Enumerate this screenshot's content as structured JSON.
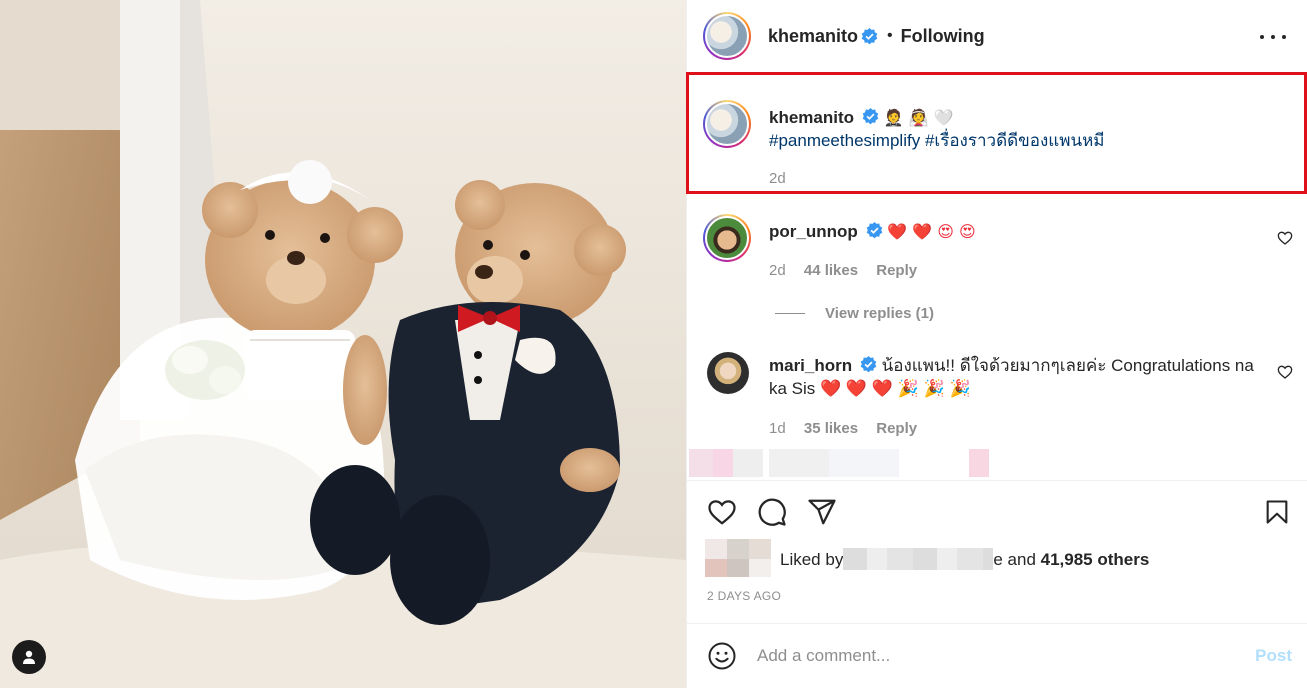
{
  "post": {
    "author": "khemanito",
    "follow_state": "Following",
    "separator": "•"
  },
  "caption": {
    "username": "khemanito",
    "emojis": "🤵 👰 🤍",
    "hashtag_1": "#panmeethesimplify",
    "hashtag_2": "#เรื่องราวดีดีของแพนหมี",
    "time": "2d"
  },
  "comments": [
    {
      "username": "por_unnop",
      "text": "❤️ ❤️ 😍 😍",
      "time": "2d",
      "likes": "44 likes",
      "reply": "Reply"
    },
    {
      "username": "mari_horn",
      "text": "น้องแพน!! ดีใจด้วยมากๆเลยค่ะ Congratulations na ka Sis ❤️ ❤️ ❤️ 🎉 🎉 🎉",
      "time": "1d",
      "likes": "35 likes",
      "reply": "Reply"
    }
  ],
  "view_replies": "View replies (1)",
  "likes_summary": {
    "prefix": "Liked by",
    "suffix_letter": "e",
    "and_text": "and",
    "others": "41,985 others"
  },
  "posted_date": "2 DAYS AGO",
  "comment_field": {
    "placeholder": "Add a comment...",
    "post_label": "Post"
  },
  "colors": {
    "verified": "#3897f0",
    "link": "#00376b",
    "highlight_border": "#e0101a",
    "post_disabled": "#b2dffc",
    "secondary_text": "#8e8e8e"
  },
  "icons": {
    "more": "more-icon",
    "like": "heart-icon",
    "comment": "comment-icon",
    "share": "paper-plane-icon",
    "save": "bookmark-icon",
    "emoji": "smiley-icon",
    "tags": "user-tag-icon"
  }
}
